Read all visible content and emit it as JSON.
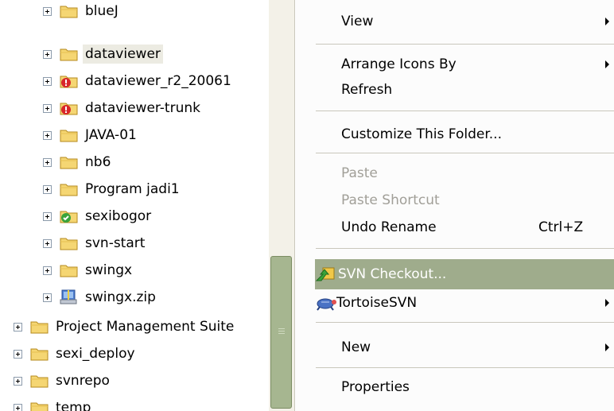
{
  "tree": {
    "items": [
      {
        "label": "blueJ",
        "icon": "folder"
      },
      {
        "label": "dataviewer",
        "icon": "folder"
      },
      {
        "label": "dataviewer_r2_20061",
        "icon": "svn-conflict-folder"
      },
      {
        "label": "dataviewer-trunk",
        "icon": "svn-conflict-folder"
      },
      {
        "label": "JAVA-01",
        "icon": "folder"
      },
      {
        "label": "nb6",
        "icon": "folder"
      },
      {
        "label": "Program jadi1",
        "icon": "folder"
      },
      {
        "label": "sexibogor",
        "icon": "svn-normal-folder"
      },
      {
        "label": "svn-start",
        "icon": "folder"
      },
      {
        "label": "swingx",
        "icon": "folder"
      },
      {
        "label": "swingx.zip",
        "icon": "zip-file"
      },
      {
        "label": "Project Management Suite",
        "icon": "folder"
      },
      {
        "label": "sexi_deploy",
        "icon": "folder"
      },
      {
        "label": "svnrepo",
        "icon": "folder"
      },
      {
        "label": "temp",
        "icon": "folder"
      }
    ]
  },
  "menu": {
    "view": "View",
    "arrange_icons_by": "Arrange Icons By",
    "refresh": "Refresh",
    "customize_folder": "Customize This Folder...",
    "paste": "Paste",
    "paste_shortcut": "Paste Shortcut",
    "undo_rename": "Undo Rename",
    "undo_rename_shortcut": "Ctrl+Z",
    "svn_checkout": "SVN Checkout...",
    "tortoisesvn": "TortoiseSVN",
    "new": "New",
    "properties": "Properties"
  },
  "colors": {
    "folder": "#f5d673",
    "menu_highlight": "#9fac8c",
    "scroll_thumb": "#a6b690",
    "selection": "#ecebe2"
  }
}
